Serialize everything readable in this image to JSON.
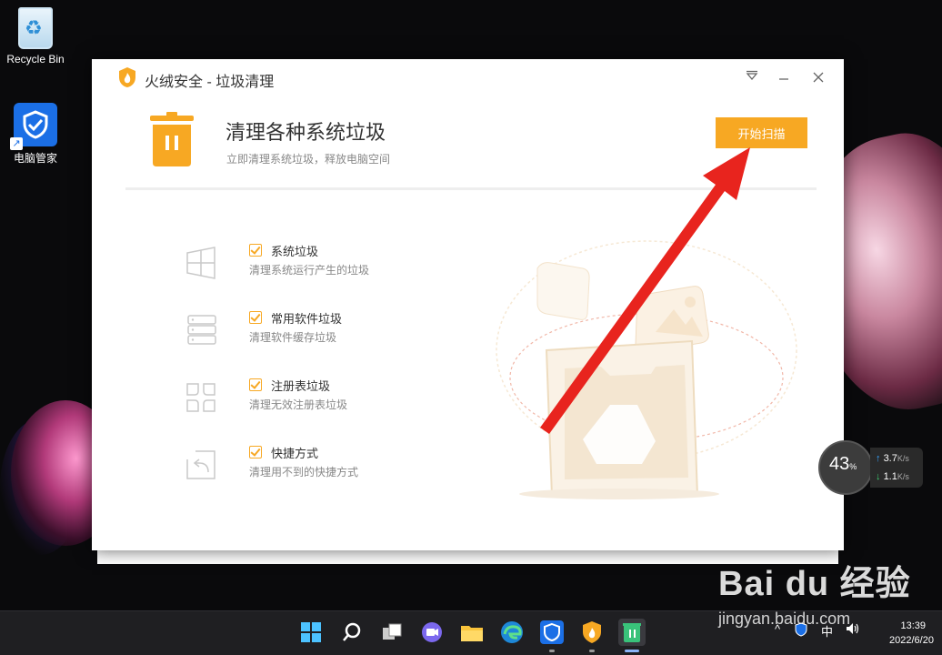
{
  "desktop": {
    "icons": [
      {
        "label": "Recycle Bin"
      },
      {
        "label": "电脑管家"
      }
    ]
  },
  "window": {
    "title": "火绒安全 - 垃圾清理",
    "header": {
      "title": "清理各种系统垃圾",
      "subtitle": "立即清理系统垃圾，释放电脑空间",
      "scan_button": "开始扫描"
    },
    "items": [
      {
        "label": "系统垃圾",
        "desc": "清理系统运行产生的垃圾",
        "checked": true,
        "icon": "windows-icon"
      },
      {
        "label": "常用软件垃圾",
        "desc": "清理软件缓存垃圾",
        "checked": true,
        "icon": "database-icon"
      },
      {
        "label": "注册表垃圾",
        "desc": "清理无效注册表垃圾",
        "checked": true,
        "icon": "registry-icon"
      },
      {
        "label": "快捷方式",
        "desc": "清理用不到的快捷方式",
        "checked": true,
        "icon": "shortcut-icon"
      }
    ],
    "accent_color": "#f7a823"
  },
  "speed_widget": {
    "percent": "43",
    "percent_unit": "%",
    "up": "3.7",
    "down": "1.1",
    "unit": "K/s"
  },
  "taskbar": {
    "tray_input": "中",
    "time": "13:39",
    "date": "2022/6/20"
  },
  "watermark": {
    "logo": "Bai du 经验",
    "url": "jingyan.baidu.com"
  }
}
